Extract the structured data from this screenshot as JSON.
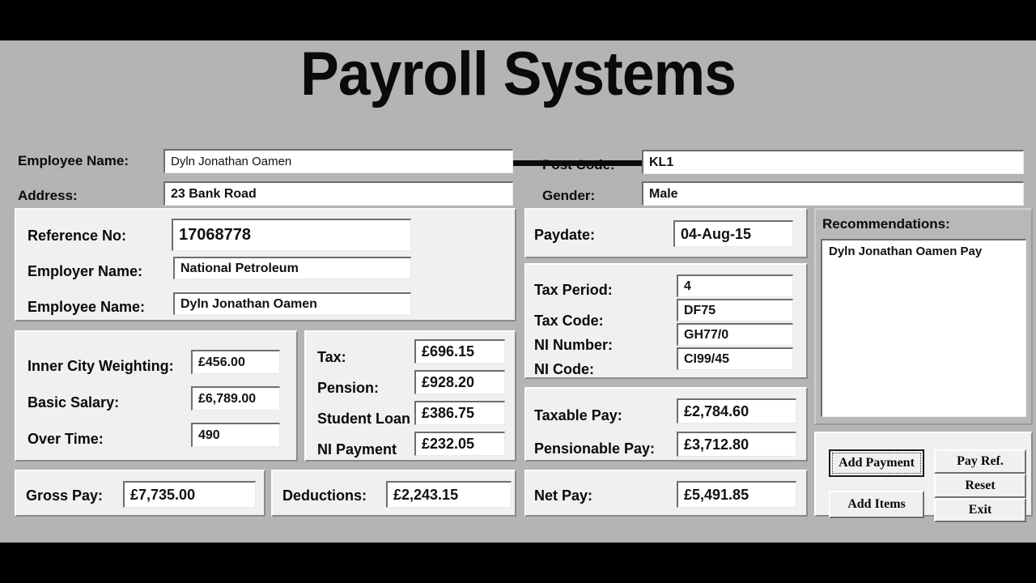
{
  "title": "Payroll Systems",
  "header": {
    "employee_name_label": "Employee Name:",
    "employee_name_value": "Dyln Jonathan Oamen",
    "address_label": "Address:",
    "address_value": "23 Bank Road",
    "post_code_label": "Post Code:",
    "post_code_value": "KL1",
    "gender_label": "Gender:",
    "gender_value": "Male"
  },
  "employer_panel": {
    "reference_no_label": "Reference No:",
    "reference_no_value": "17068778",
    "employer_name_label": "Employer Name:",
    "employer_name_value": "National Petroleum",
    "employee_name_label": "Employee Name:",
    "employee_name_value": "Dyln Jonathan Oamen"
  },
  "earnings_panel": {
    "inner_city_label": "Inner City Weighting:",
    "inner_city_value": "£456.00",
    "basic_salary_label": "Basic Salary:",
    "basic_salary_value": "£6,789.00",
    "over_time_label": "Over Time:",
    "over_time_value": "490"
  },
  "deductions_panel": {
    "tax_label": "Tax:",
    "tax_value": "£696.15",
    "pension_label": "Pension:",
    "pension_value": "£928.20",
    "student_loan_label": "Student Loan",
    "student_loan_value": "£386.75",
    "ni_payment_label": "NI Payment",
    "ni_payment_value": "£232.05"
  },
  "paydate_panel": {
    "paydate_label": "Paydate:",
    "paydate_value": "04-Aug-15"
  },
  "tax_panel": {
    "tax_period_label": "Tax Period:",
    "tax_period_value": "4",
    "tax_code_label": "Tax Code:",
    "tax_code_value": "DF75",
    "ni_number_label": "NI Number:",
    "ni_number_value": "GH77/0",
    "ni_code_label": "NI Code:",
    "ni_code_value": "CI99/45"
  },
  "pay_panel": {
    "taxable_pay_label": "Taxable Pay:",
    "taxable_pay_value": "£2,784.60",
    "pensionable_pay_label": "Pensionable Pay:",
    "pensionable_pay_value": "£3,712.80"
  },
  "totals": {
    "gross_pay_label": "Gross Pay:",
    "gross_pay_value": "£7,735.00",
    "deductions_label": "Deductions:",
    "deductions_value": "£2,243.15",
    "net_pay_label": "Net Pay:",
    "net_pay_value": "£5,491.85"
  },
  "recommendations": {
    "label": "Recommendations:",
    "items": [
      "Dyln Jonathan Oamen Pay"
    ]
  },
  "buttons": {
    "add_payment": "Add Payment",
    "add_items": "Add Items",
    "pay_ref": "Pay Ref.",
    "reset": "Reset",
    "exit": "Exit"
  },
  "colors": {
    "background": "#b4b4b4",
    "panel": "#f0f0f0",
    "field": "#ffffff",
    "text": "#0a0a0a",
    "letterbox": "#000000"
  }
}
